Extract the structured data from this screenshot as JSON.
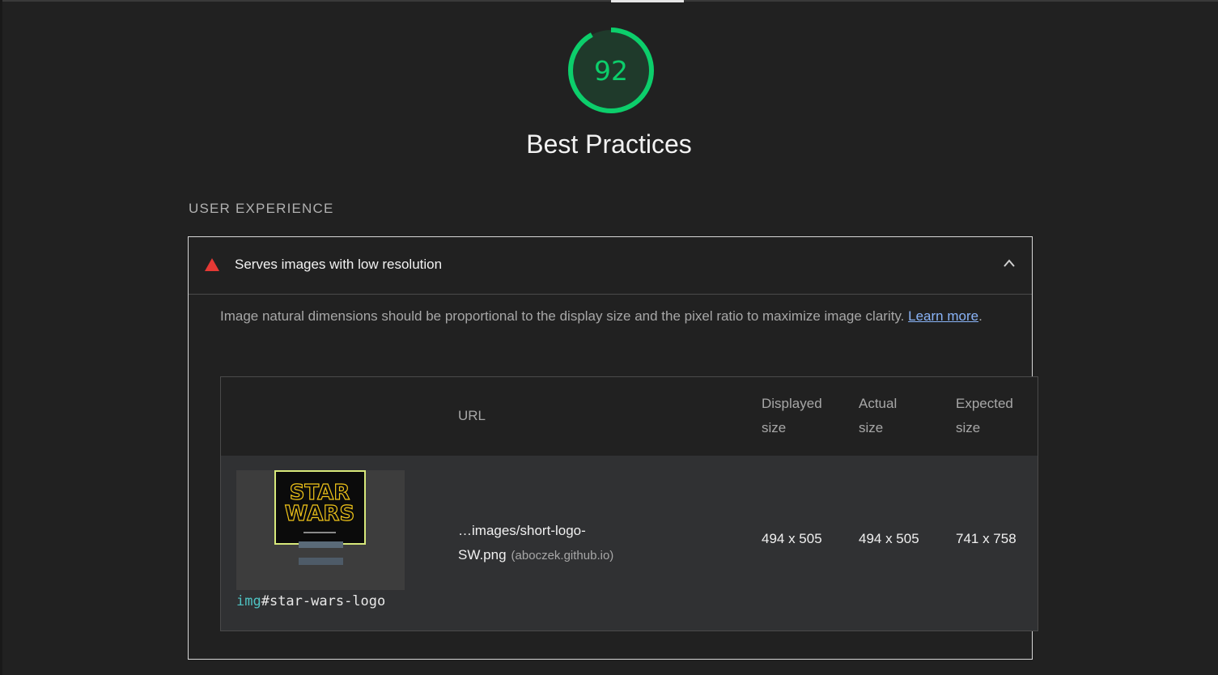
{
  "score": {
    "value": "92",
    "color": "#0cce6b",
    "fraction": 0.92
  },
  "category_title": "Best Practices",
  "group_title": "USER EXPERIENCE",
  "audit": {
    "icon": "warning-triangle-icon",
    "title": "Serves images with low resolution",
    "description": "Image natural dimensions should be proportional to the display size and the pixel ratio to maximize image clarity.",
    "learn_more": "Learn more",
    "learn_more_suffix": "."
  },
  "table": {
    "headers": {
      "url": "URL",
      "displayed": "Displayed size",
      "actual": "Actual size",
      "expected": "Expected size"
    },
    "rows": [
      {
        "node_tag": "img",
        "node_selector": "#star-wars-logo",
        "thumbnail_text": "STAR WARS",
        "url": "…images/short-logo-SW.png",
        "host": "(aboczek.github.io)",
        "displayed": "494 x 505",
        "actual": "494 x 505",
        "expected": "741 x 758"
      }
    ]
  }
}
